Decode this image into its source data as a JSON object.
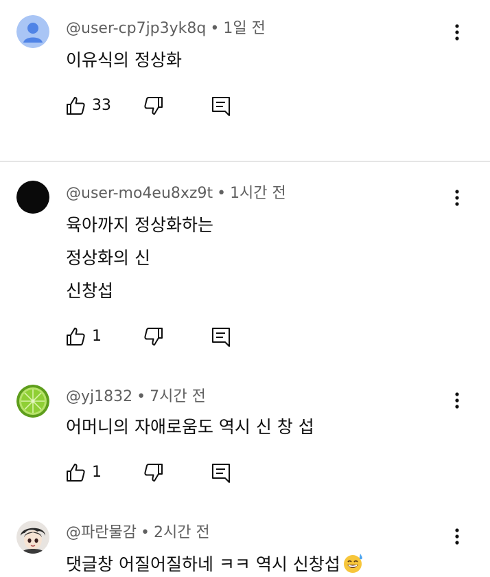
{
  "comments": [
    {
      "author": "@user-cp7jp3yk8q",
      "time": "1일 전",
      "lines": [
        "이유식의 정상화"
      ],
      "likes": "33",
      "avatar": "default-person-icon",
      "avatar_color": "#4f83e6"
    },
    {
      "author": "@user-mo4eu8xz9t",
      "time": "1시간 전",
      "lines": [
        "육아까지  정상화하는",
        "정상화의 신",
        "신창섭"
      ],
      "likes": "1",
      "avatar": "black-circle-avatar",
      "avatar_color": "#0a0a0a"
    },
    {
      "author": "@yj1832",
      "time": "7시간 전",
      "lines": [
        "어머니의 자애로움도 역시 신 창 섭"
      ],
      "likes": "1",
      "avatar": "lime-slice-avatar",
      "avatar_color": "#7cc22a"
    },
    {
      "author": "@파란물감",
      "time": "2시간 전",
      "lines": [
        "댓글창 어질어질하네 ㅋㅋ 역시 신창섭"
      ],
      "likes": "",
      "avatar": "anime-character-avatar",
      "avatar_color": "#3a3a3a"
    }
  ],
  "separator": "•",
  "icons": {
    "like": "thumbs-up-icon",
    "dislike": "thumbs-down-icon",
    "reply": "reply-comment-icon",
    "more": "more-vertical-icon",
    "emoji": "sweat-smile-emoji"
  }
}
